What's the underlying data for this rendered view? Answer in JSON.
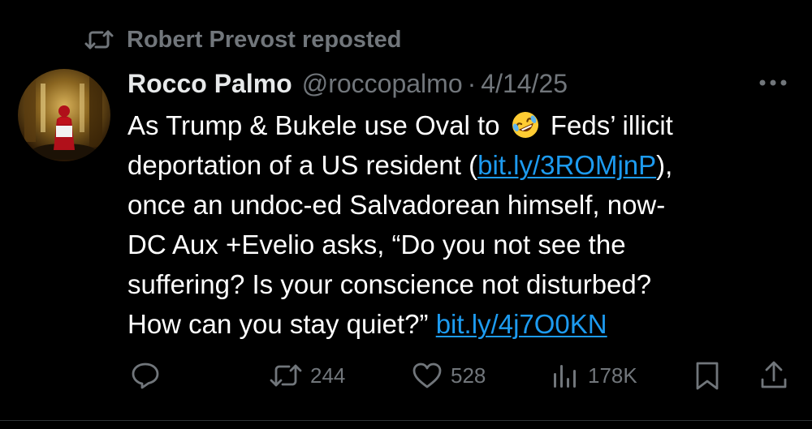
{
  "repost_banner": {
    "icon": "repost-icon",
    "text": "Robert Prevost reposted"
  },
  "author": {
    "avatar": "avatar",
    "display_name": "Rocco Palmo",
    "handle": "@roccopalmo",
    "separator": "·",
    "date": "4/14/25"
  },
  "more_icon": "more-icon",
  "body": {
    "line1_a": "As Trump & Bukele use Oval to ",
    "emoji": "rolling-on-the-floor-laughing-emoji",
    "line1_b": " Feds’ illicit",
    "line2_a": "deportation of a US resident (",
    "link1": "bit.ly/3ROMjnP",
    "line2_b": "),",
    "line3": "once an undoc-ed Salvadorean himself, now-",
    "line4": "DC Aux +Evelio asks, “Do you not see the",
    "line5": "suffering? Is your conscience not disturbed?",
    "line6_a": "How can you stay quiet?” ",
    "link2": "bit.ly/4j7O0KN"
  },
  "actions": {
    "reply": {
      "icon": "reply-icon",
      "count": ""
    },
    "repost": {
      "icon": "repost-icon",
      "count": "244"
    },
    "like": {
      "icon": "heart-icon",
      "count": "528"
    },
    "views": {
      "icon": "views-icon",
      "count": "178K"
    },
    "bookmark": {
      "icon": "bookmark-icon",
      "count": ""
    },
    "share": {
      "icon": "share-icon",
      "count": ""
    }
  },
  "colors": {
    "background": "#000000",
    "text": "#ffffff",
    "muted": "#71767b",
    "link": "#1d9bf0"
  }
}
